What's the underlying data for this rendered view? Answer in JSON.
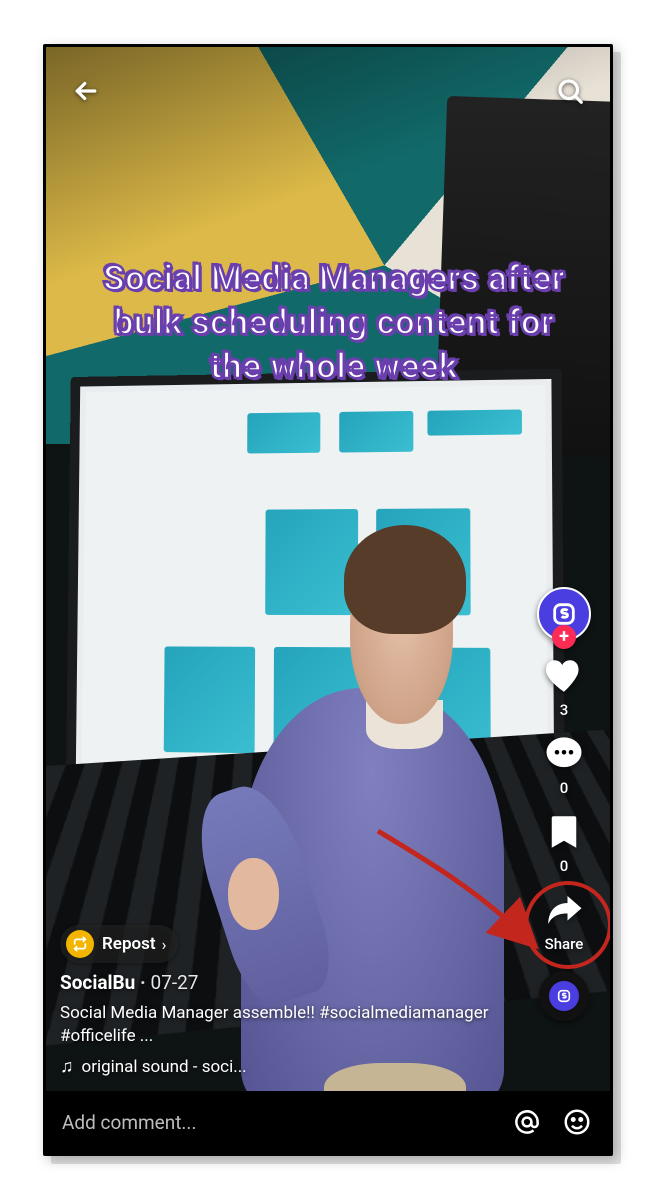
{
  "overlay_caption": "Social Media Managers after bulk scheduling content for the whole week",
  "right_rail": {
    "like_count": "3",
    "comment_count": "0",
    "bookmark_count": "0",
    "share_label": "Share"
  },
  "meta": {
    "repost_label": "Repost",
    "username": "SocialBu",
    "date": "07-27",
    "caption": "Social Media Manager assemble!! #socialmediamanager #officelife ...",
    "sound_text": "original sound - soci..."
  },
  "comment_bar": {
    "placeholder": "Add comment..."
  },
  "icons": {
    "back": "back-arrow-icon",
    "search": "search-icon",
    "like": "heart-icon",
    "comment": "comment-icon",
    "bookmark": "bookmark-icon",
    "share": "share-arrow-icon",
    "mention": "mention-icon",
    "emoji": "emoji-icon",
    "repost": "repost-icon",
    "music": "music-note-icon",
    "follow_plus": "plus-icon",
    "avatar": "profile-avatar",
    "disc": "sound-disc"
  },
  "annotation": {
    "target": "share-button",
    "shape": "circle-with-arrow",
    "color": "#c3261d"
  }
}
